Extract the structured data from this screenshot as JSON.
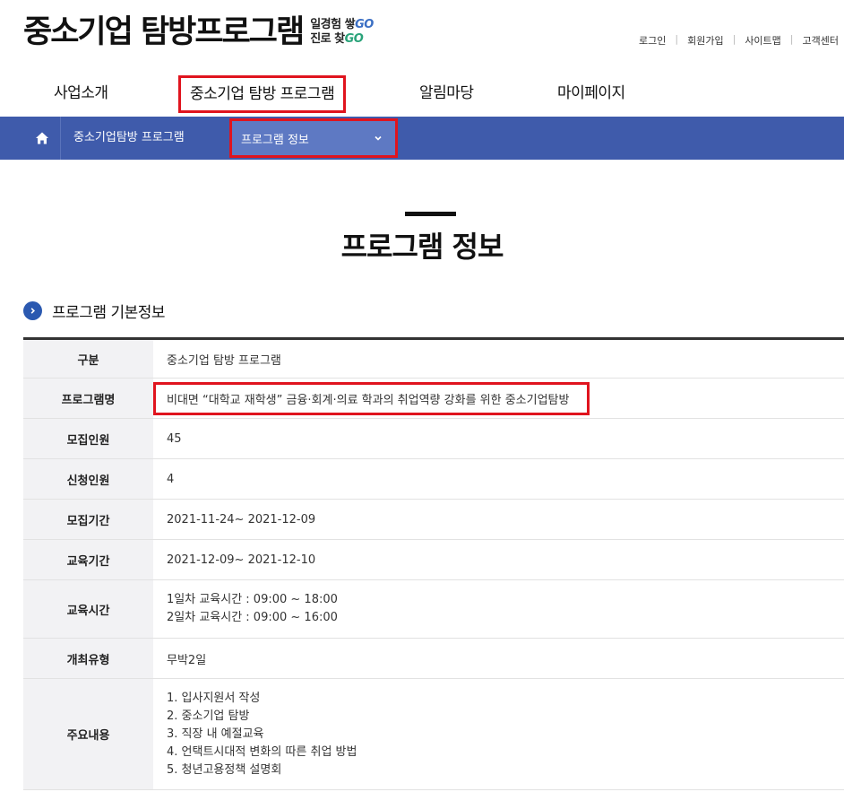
{
  "header": {
    "logo_main": "중소기업 탐방프로그램",
    "logo_sub_line1": "일경험 쌓",
    "logo_sub_go1": "GO",
    "logo_sub_line2": "진로 찾",
    "logo_sub_go2": "GO",
    "util_links": [
      "로그인",
      "회원가입",
      "사이트맵",
      "고객센터"
    ]
  },
  "gnb": {
    "items": [
      "사업소개",
      "중소기업 탐방 프로그램",
      "알림마당",
      "마이페이지"
    ],
    "active_index": 1
  },
  "breadcrumb": {
    "home_icon": "home-icon",
    "item": "중소기업탐방 프로그램",
    "select_value": "프로그램 정보",
    "select_icon": "chevron-down-icon"
  },
  "page": {
    "title": "프로그램 정보"
  },
  "section": {
    "icon": "chevron-right-icon",
    "title": "프로그램 기본정보"
  },
  "table": {
    "rows": [
      {
        "label": "구분",
        "value": "중소기업 탐방 프로그램"
      },
      {
        "label": "프로그램명",
        "value": "비대면 “대학교 재학생” 금융·회계·의료 학과의 취업역량 강화를 위한 중소기업탐방"
      },
      {
        "label": "모집인원",
        "value": "45"
      },
      {
        "label": "신청인원",
        "value": "4"
      },
      {
        "label": "모집기간",
        "value": "2021-11-24~ 2021-12-09"
      },
      {
        "label": "교육기간",
        "value": "2021-12-09~ 2021-12-10"
      },
      {
        "label": "교육시간",
        "lines": [
          "1일차 교육시간 : 09:00 ~ 18:00",
          "2일차 교육시간 : 09:00 ~ 16:00"
        ]
      },
      {
        "label": "개최유형",
        "value": "무박2일"
      },
      {
        "label": "주요내용",
        "lines": [
          "1. 입사지원서 작성",
          "2. 중소기업 탐방",
          "3. 직장 내 예절교육",
          "4. 언택트시대적 변화의 따른 취업 방법",
          "5. 청년고용정책 설명회"
        ]
      }
    ]
  },
  "colors": {
    "bar": "#3f5bab",
    "select_bg": "#5e79c3",
    "highlight": "#e0141e",
    "accent": "#2b59b0"
  }
}
